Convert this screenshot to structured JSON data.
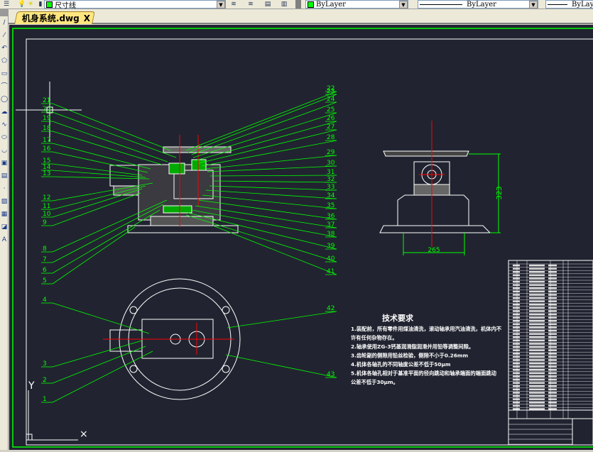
{
  "toolbar": {
    "layer_name": "尺寸线",
    "layer_color": "#00ff00",
    "color_value": "ByLayer",
    "linetype_value": "ByLayer",
    "lineweight_value": "ByLayer",
    "icons": [
      "layer-manager-icon",
      "bulb-icon",
      "sun-icon",
      "lock-icon",
      "layer-previous-icon",
      "layer-state-icon",
      "layer-match-icon",
      "layer-iso-icon"
    ]
  },
  "tab": {
    "label": "机身系统.dwg",
    "close": "X"
  },
  "left_tools": [
    "line",
    "construction-line",
    "polyline",
    "polygon",
    "rectangle",
    "arc",
    "circle",
    "revcloud",
    "spline",
    "ellipse",
    "ellipse-arc",
    "insert-block",
    "make-block",
    "point",
    "hatch",
    "gradient",
    "region",
    "multiline-text"
  ],
  "drawing": {
    "colors": {
      "background": "#212430",
      "geometry": "#ffffff",
      "leaders": "#00ff00",
      "centerlines": "#ff0000"
    },
    "balloons_left": [
      "21",
      "20",
      "19",
      "18",
      "17",
      "16",
      "15",
      "14",
      "13",
      "12",
      "11",
      "10",
      "9",
      "8",
      "7",
      "6",
      "5"
    ],
    "balloons_right": [
      "22",
      "23",
      "24",
      "25",
      "26",
      "27",
      "28",
      "29",
      "30",
      "31",
      "32",
      "33",
      "34",
      "35",
      "36",
      "37",
      "38",
      "39",
      "40",
      "41"
    ],
    "balloons_plan_left": [
      "4",
      "3",
      "2",
      "1"
    ],
    "balloons_plan_right": [
      "42",
      "43"
    ],
    "dim_height": "323",
    "dim_width": "265",
    "tech_title": "技术要求",
    "tech_lines": [
      "1.装配前，所有零件用煤油清洗，滚动轴承用汽油清洗，机体内不",
      "许有任何杂物存在。",
      "2.轴承使用ZG-3钙基润滑脂润滑并用铅等调整间隙。",
      "3.齿轮副的侧隙用铅丝检验，侧隙不小于0.26mm",
      "4.机体各轴孔的不同轴度公差不低于50μm",
      "5.机体各轴孔相对于基准平面的径向跳动和轴承端面的端面跳动",
      "公差不低于30μm。"
    ],
    "ucs_label": "Y"
  }
}
